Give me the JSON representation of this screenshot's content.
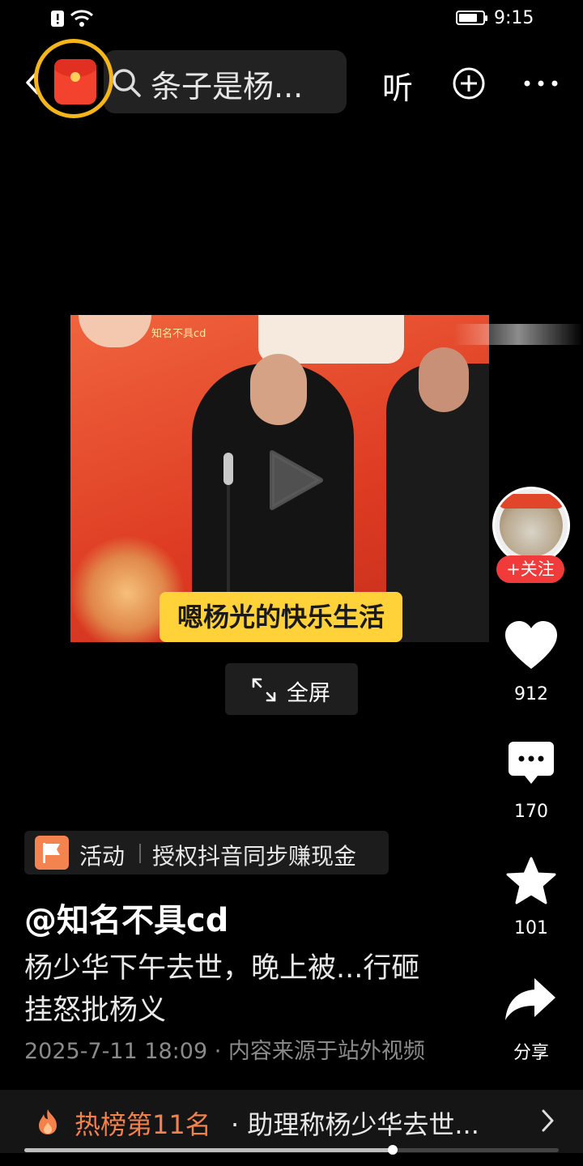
{
  "status_bar": {
    "time": "9:15",
    "battery_level": 0.8
  },
  "header": {
    "search_text": "条子是杨...",
    "listen_label": "听"
  },
  "video": {
    "watermark": "知名不具cd",
    "caption": "嗯杨光的快乐生活",
    "fullscreen_label": "全屏"
  },
  "side_actions": {
    "follow_label": "+关注",
    "like_count": "912",
    "comment_count": "170",
    "favorite_count": "101",
    "share_label": "分享"
  },
  "activity": {
    "label": "活动",
    "text": "授权抖音同步赚现金"
  },
  "post": {
    "author": "@知名不具cd",
    "description": "杨少华下午去世，晚上被...行砸挂怒批杨义",
    "meta": "2025-7-11 18:09 · 内容来源于站外视频"
  },
  "hot_list": {
    "rank_text": "热榜第11名",
    "headline": "· 助理称杨少华去世..."
  },
  "playback": {
    "progress": 0.69
  },
  "colors": {
    "accent_red": "#f13b3b",
    "hot_orange": "#f2814c",
    "redbag_ring": "#f3b51a"
  }
}
